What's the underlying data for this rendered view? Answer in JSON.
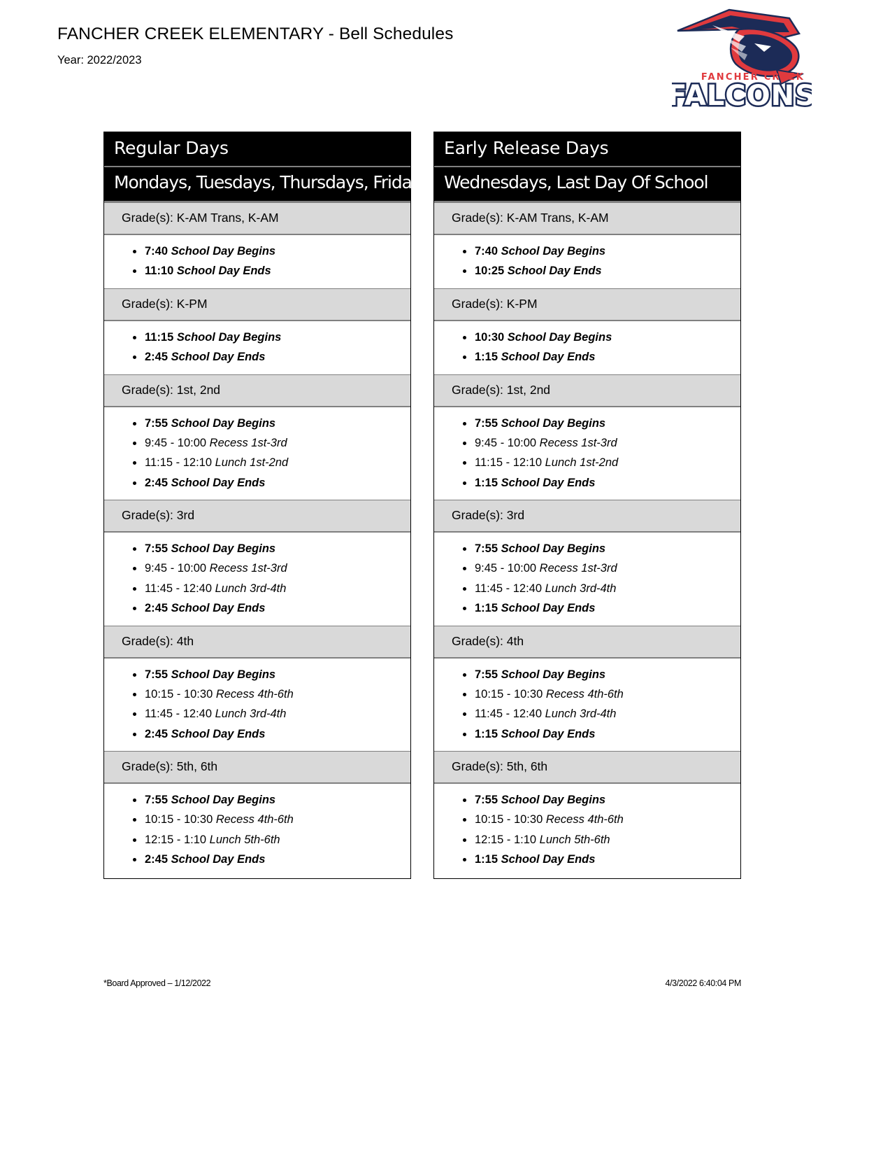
{
  "header": {
    "title": "FANCHER CREEK ELEMENTARY - Bell Schedules",
    "year_label": "Year: 2022/2023"
  },
  "logo": {
    "school_text": "FANCHER CREEK",
    "mascot_text": "FALCONS",
    "red": "#E03A3E",
    "navy": "#1C2B57",
    "white": "#FFFFFF"
  },
  "footer": {
    "left": "*Board Approved – 1/12/2022",
    "right": "4/3/2022 6:40:04 PM"
  },
  "tables": [
    {
      "title": "Regular Days",
      "subtitle": "Mondays, Tuesdays, Thursdays, Fridays",
      "sections": [
        {
          "grade_label": "Grade(s): K-AM Trans, K-AM",
          "events": [
            {
              "time": "7:40",
              "label": "School Day Begins",
              "bold": true
            },
            {
              "time": "11:10",
              "label": "School Day Ends",
              "bold": true
            }
          ]
        },
        {
          "grade_label": "Grade(s): K-PM",
          "events": [
            {
              "time": "11:15",
              "label": "School Day Begins",
              "bold": true
            },
            {
              "time": "2:45",
              "label": "School Day Ends",
              "bold": true
            }
          ]
        },
        {
          "grade_label": "Grade(s): 1st, 2nd",
          "events": [
            {
              "time": "7:55",
              "label": "School Day Begins",
              "bold": true
            },
            {
              "time": "9:45 - 10:00",
              "label": "Recess 1st-3rd",
              "bold": false
            },
            {
              "time": "11:15 - 12:10",
              "label": "Lunch 1st-2nd",
              "bold": false
            },
            {
              "time": "2:45",
              "label": "School Day Ends",
              "bold": true
            }
          ]
        },
        {
          "grade_label": "Grade(s): 3rd",
          "events": [
            {
              "time": "7:55",
              "label": "School Day Begins",
              "bold": true
            },
            {
              "time": "9:45 - 10:00",
              "label": "Recess 1st-3rd",
              "bold": false
            },
            {
              "time": "11:45 - 12:40",
              "label": "Lunch 3rd-4th",
              "bold": false
            },
            {
              "time": "2:45",
              "label": "School Day Ends",
              "bold": true
            }
          ]
        },
        {
          "grade_label": "Grade(s): 4th",
          "events": [
            {
              "time": "7:55",
              "label": "School Day Begins",
              "bold": true
            },
            {
              "time": "10:15 - 10:30",
              "label": "Recess 4th-6th",
              "bold": false
            },
            {
              "time": "11:45 - 12:40",
              "label": "Lunch 3rd-4th",
              "bold": false
            },
            {
              "time": "2:45",
              "label": "School Day Ends",
              "bold": true
            }
          ]
        },
        {
          "grade_label": "Grade(s): 5th, 6th",
          "events": [
            {
              "time": "7:55",
              "label": "School Day Begins",
              "bold": true
            },
            {
              "time": "10:15 - 10:30",
              "label": "Recess 4th-6th",
              "bold": false
            },
            {
              "time": "12:15 - 1:10",
              "label": "Lunch 5th-6th",
              "bold": false
            },
            {
              "time": "2:45",
              "label": "School Day Ends",
              "bold": true
            }
          ]
        }
      ]
    },
    {
      "title": "Early Release Days",
      "subtitle": "Wednesdays, Last Day Of School",
      "sections": [
        {
          "grade_label": "Grade(s): K-AM Trans, K-AM",
          "events": [
            {
              "time": "7:40",
              "label": "School Day Begins",
              "bold": true
            },
            {
              "time": "10:25",
              "label": "School Day Ends",
              "bold": true
            }
          ]
        },
        {
          "grade_label": "Grade(s): K-PM",
          "events": [
            {
              "time": "10:30",
              "label": "School Day Begins",
              "bold": true
            },
            {
              "time": "1:15",
              "label": "School Day Ends",
              "bold": true
            }
          ]
        },
        {
          "grade_label": "Grade(s): 1st, 2nd",
          "events": [
            {
              "time": "7:55",
              "label": "School Day Begins",
              "bold": true
            },
            {
              "time": "9:45 - 10:00",
              "label": "Recess 1st-3rd",
              "bold": false
            },
            {
              "time": "11:15 - 12:10",
              "label": "Lunch 1st-2nd",
              "bold": false
            },
            {
              "time": "1:15",
              "label": "School Day Ends",
              "bold": true
            }
          ]
        },
        {
          "grade_label": "Grade(s): 3rd",
          "events": [
            {
              "time": "7:55",
              "label": "School Day Begins",
              "bold": true
            },
            {
              "time": "9:45 - 10:00",
              "label": "Recess 1st-3rd",
              "bold": false
            },
            {
              "time": "11:45 - 12:40",
              "label": "Lunch 3rd-4th",
              "bold": false
            },
            {
              "time": "1:15",
              "label": "School Day Ends",
              "bold": true
            }
          ]
        },
        {
          "grade_label": "Grade(s): 4th",
          "events": [
            {
              "time": "7:55",
              "label": "School Day Begins",
              "bold": true
            },
            {
              "time": "10:15 - 10:30",
              "label": "Recess 4th-6th",
              "bold": false
            },
            {
              "time": "11:45 - 12:40",
              "label": "Lunch 3rd-4th",
              "bold": false
            },
            {
              "time": "1:15",
              "label": "School Day Ends",
              "bold": true
            }
          ]
        },
        {
          "grade_label": "Grade(s): 5th, 6th",
          "events": [
            {
              "time": "7:55",
              "label": "School Day Begins",
              "bold": true
            },
            {
              "time": "10:15 - 10:30",
              "label": "Recess 4th-6th",
              "bold": false
            },
            {
              "time": "12:15 - 1:10",
              "label": "Lunch 5th-6th",
              "bold": false
            },
            {
              "time": "1:15",
              "label": "School Day Ends",
              "bold": true
            }
          ]
        }
      ]
    }
  ]
}
